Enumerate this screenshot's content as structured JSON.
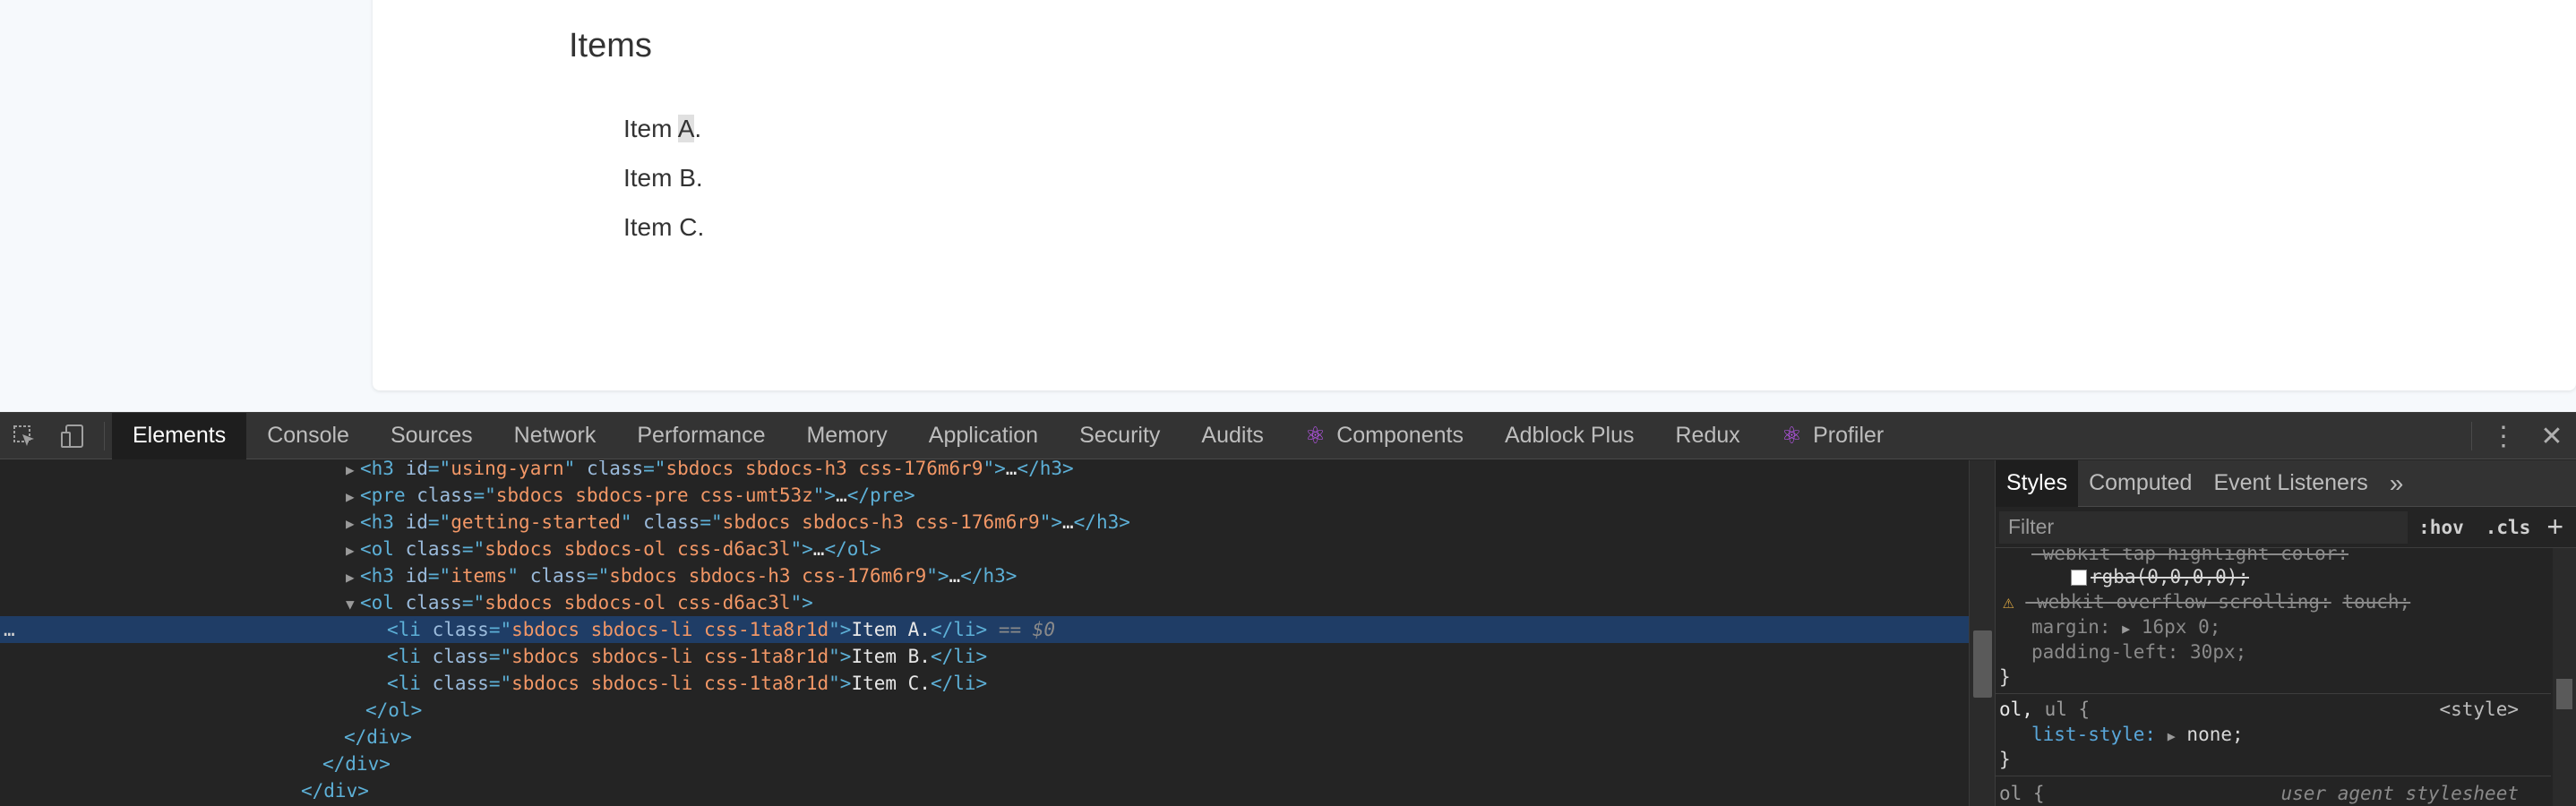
{
  "page": {
    "heading": "Items",
    "items": [
      {
        "pre": "Item ",
        "hl": "A",
        "post": "."
      },
      {
        "pre": "Item B.",
        "hl": "",
        "post": ""
      },
      {
        "pre": "Item C.",
        "hl": "",
        "post": ""
      }
    ]
  },
  "devtools": {
    "tabs": [
      "Elements",
      "Console",
      "Sources",
      "Network",
      "Performance",
      "Memory",
      "Application",
      "Security",
      "Audits",
      "Components",
      "Adblock Plus",
      "Redux",
      "Profiler"
    ],
    "active_tab": "Elements",
    "more_icon": "kebab-menu-icon",
    "close_icon": "close-icon",
    "dom": {
      "l1": {
        "tag": "h3",
        "id": "using-yarn",
        "cls": "sbdocs sbdocs-h3 css-176m6r9",
        "ellipsis": "…"
      },
      "l2": {
        "tag": "pre",
        "cls": "sbdocs sbdocs-pre css-umt53z",
        "ellipsis": "…"
      },
      "l3": {
        "tag": "h3",
        "id": "getting-started",
        "cls": "sbdocs sbdocs-h3 css-176m6r9",
        "ellipsis": "…"
      },
      "l4": {
        "tag": "ol",
        "cls": "sbdocs sbdocs-ol css-d6ac3l",
        "ellipsis": "…"
      },
      "l5": {
        "tag": "h3",
        "id": "items",
        "cls": "sbdocs sbdocs-h3 css-176m6r9",
        "ellipsis": "…"
      },
      "l6": {
        "tag": "ol",
        "cls": "sbdocs sbdocs-ol css-d6ac3l"
      },
      "li_cls": "sbdocs sbdocs-li css-1ta8r1d",
      "li_texts": [
        "Item A.",
        "Item B.",
        "Item C."
      ],
      "selected_marker": "== $0",
      "close_ol": "</ol>",
      "close_div": "</div>"
    },
    "styles": {
      "tabs": [
        "Styles",
        "Computed",
        "Event Listeners"
      ],
      "active_tab": "Styles",
      "filter_placeholder": "Filter",
      "hov": ":hov",
      "cls": ".cls",
      "rule1": {
        "p1_name": "-webkit-tap-highlight-color:",
        "p1_value": "rgba(0,0,0,0);",
        "p2_name": "-webkit-overflow-scrolling:",
        "p2_value": "touch;",
        "p3_name": "margin:",
        "p3_value": "16px 0;",
        "p4_name": "padding-left:",
        "p4_value": "30px;"
      },
      "rule2": {
        "selector_match": "ol,",
        "selector_rest": " ul {",
        "source": "<style>",
        "p1_name": "list-style:",
        "p1_value": "none;"
      },
      "rule3": {
        "selector": "ol {",
        "source": "user agent stylesheet"
      }
    }
  }
}
